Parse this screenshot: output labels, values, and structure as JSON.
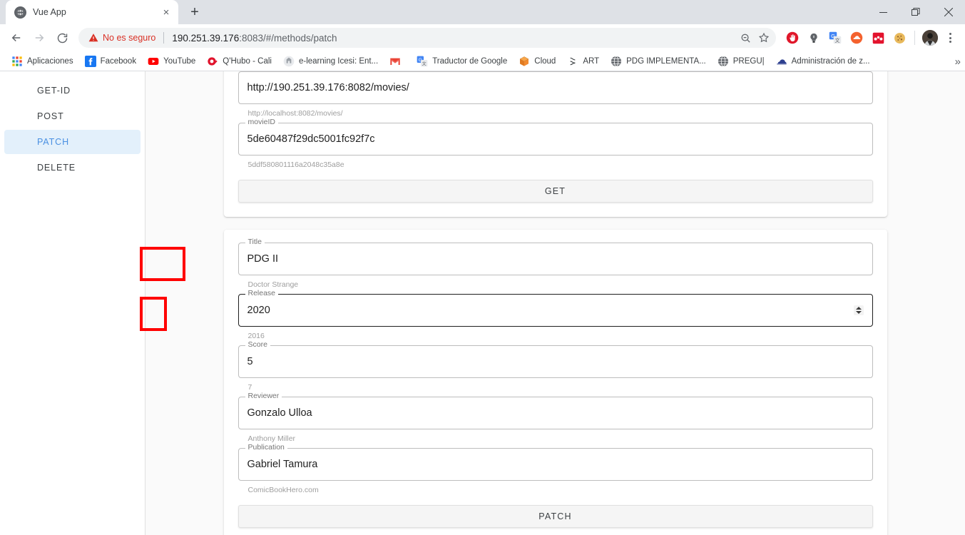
{
  "browser": {
    "tab": {
      "title": "Vue App",
      "favicon": "globe-icon",
      "close": "×"
    },
    "new_tab": "+",
    "window": {
      "minimize": "—",
      "maximize": "❐",
      "close": "✕"
    },
    "nav": {
      "back": "←",
      "forward": "→",
      "reload": "⟳"
    },
    "omnibox": {
      "security_label": "No es seguro",
      "url_host": "190.251.39.176",
      "url_rest": ":8083/#/methods/patch",
      "zoom_icon": "zoom-out-icon",
      "star_icon": "bookmark-star-icon"
    },
    "extensions": [
      {
        "name": "adblock-icon"
      },
      {
        "name": "lamp-icon"
      },
      {
        "name": "google-translate-icon"
      },
      {
        "name": "cloud-icon"
      },
      {
        "name": "mendeley-icon"
      },
      {
        "name": "cookie-icon"
      }
    ],
    "profile_avatar": "user-avatar",
    "menu": "chrome-menu-icon",
    "bookmarks": [
      {
        "label": "Aplicaciones",
        "icon": "apps-grid-icon"
      },
      {
        "label": "Facebook",
        "icon": "facebook-icon"
      },
      {
        "label": "YouTube",
        "icon": "youtube-icon"
      },
      {
        "label": "Q'Hubo - Cali",
        "icon": "qhubo-icon"
      },
      {
        "label": "e-learning Icesi: Ent...",
        "icon": "icesi-icon"
      },
      {
        "label": "",
        "icon": "gmail-icon"
      },
      {
        "label": "Traductor de Google",
        "icon": "google-translate-icon"
      },
      {
        "label": "Cloud",
        "icon": "cloud-box-icon"
      },
      {
        "label": "ART",
        "icon": "art-icon"
      },
      {
        "label": "PDG IMPLEMENTA...",
        "icon": "globe-icon"
      },
      {
        "label": "PREGU|",
        "icon": "globe-icon"
      },
      {
        "label": "Administración de z...",
        "icon": "cloud-admin-icon"
      }
    ],
    "bookmarks_overflow": "»"
  },
  "sidebar": {
    "items": [
      {
        "label": "GET-ID",
        "active": false
      },
      {
        "label": "POST",
        "active": false
      },
      {
        "label": "PATCH",
        "active": true
      },
      {
        "label": "DELETE",
        "active": false
      }
    ]
  },
  "get_card": {
    "url_field": {
      "legend": "",
      "value": "http://190.251.39.176:8082/movies/",
      "hint": "http://localhost:8082/movies/"
    },
    "movie_id_field": {
      "legend": "movieID",
      "value": "5de60487f29dc5001fc92f7c",
      "hint": "5ddf580801116a2048c35a8e"
    },
    "submit_label": "GET"
  },
  "patch_card": {
    "fields": [
      {
        "legend": "Title",
        "value": "PDG II",
        "hint": "Doctor Strange",
        "type": "text"
      },
      {
        "legend": "Release",
        "value": "2020",
        "hint": "2016",
        "type": "number",
        "highlighted": true
      },
      {
        "legend": "Score",
        "value": "5",
        "hint": "7",
        "type": "text",
        "highlighted": true
      },
      {
        "legend": "Reviewer",
        "value": "Gonzalo Ulloa",
        "hint": "Anthony Miller",
        "type": "text"
      },
      {
        "legend": "Publication",
        "value": "Gabriel Tamura",
        "hint": "ComicBookHero.com",
        "type": "text"
      }
    ],
    "submit_label": "PATCH"
  },
  "colors": {
    "accent": "#4a90e2",
    "active_bg": "#e3f0fb",
    "annotation": "#ff0000",
    "insecure": "#d93025",
    "page_bg": "#fafafa"
  }
}
